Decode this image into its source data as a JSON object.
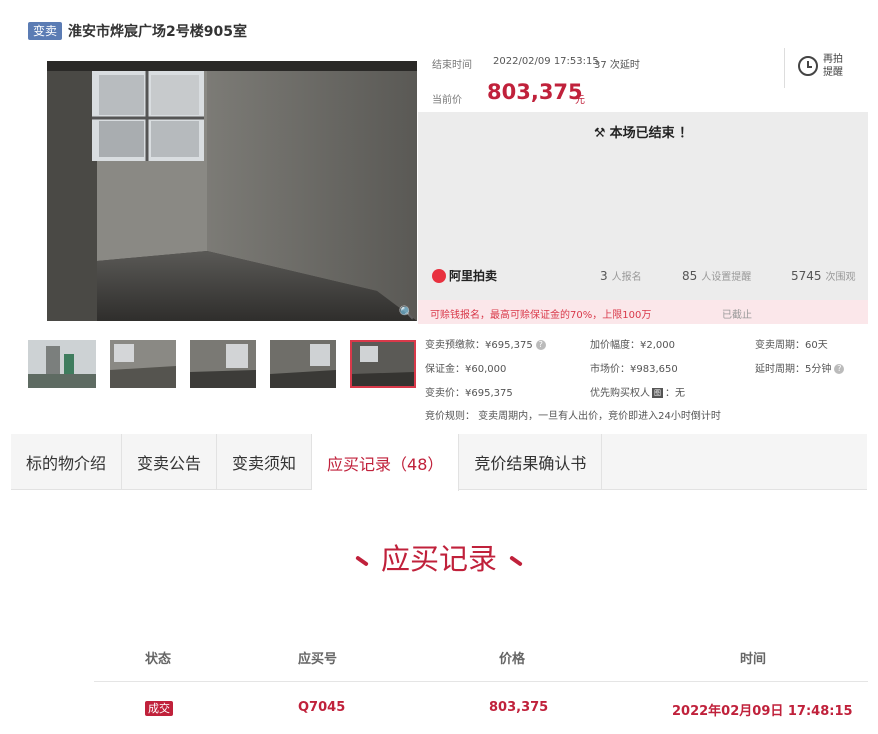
{
  "title": {
    "tag": "变卖",
    "text": "淮安市烨宸广场2号楼905室"
  },
  "auction": {
    "end_label": "结束时间",
    "end_time": "2022/02/09 17:53:15",
    "delay_count": "37",
    "delay_label": "次延时",
    "current_label": "当前价",
    "current_price": "803,375",
    "currency_unit": "元",
    "remind_label": "再拍提醒",
    "ended_text": "本场已结束 ！"
  },
  "stats": {
    "logo_text": "阿里拍卖",
    "signups": "3",
    "signups_label": "人报名",
    "reminders": "85",
    "reminders_label": "人设置提醒",
    "views": "5745",
    "views_label": "次围观"
  },
  "pledge": {
    "text": "可赊钱报名，最高可赊保证金的70%，上限100万",
    "status": "已截止"
  },
  "details": {
    "prepay": "变卖预缴款：¥695,375",
    "increment": "加价幅度：¥2,000",
    "period": "变卖周期：60天",
    "deposit": "保证金：¥60,000",
    "market": "市场价：¥983,650",
    "delay_period": "延时周期：5分钟",
    "sale_price": "变卖价：¥695,375",
    "priority_prefix": "优先购买权人",
    "priority_icon": "图",
    "priority_value": "：无",
    "rules": "竞价规则： 变卖周期内，一旦有人出价，竞价即进入24小时倒计时"
  },
  "tabs": [
    {
      "label": "标的物介绍"
    },
    {
      "label": "变卖公告"
    },
    {
      "label": "变卖须知"
    },
    {
      "label": "应买记录（48）"
    },
    {
      "label": "竞价结果确认书"
    }
  ],
  "records": {
    "title": "应买记录",
    "headers": {
      "status": "状态",
      "number": "应买号",
      "price": "价格",
      "time": "时间"
    },
    "rows": [
      {
        "status": "成交",
        "number": "Q7045",
        "price": "803,375",
        "time": "2022年02月09日 17:48:15"
      }
    ]
  },
  "colors": {
    "accent": "#c0213b",
    "tag": "#5b7cb4",
    "panel": "#ececec"
  }
}
